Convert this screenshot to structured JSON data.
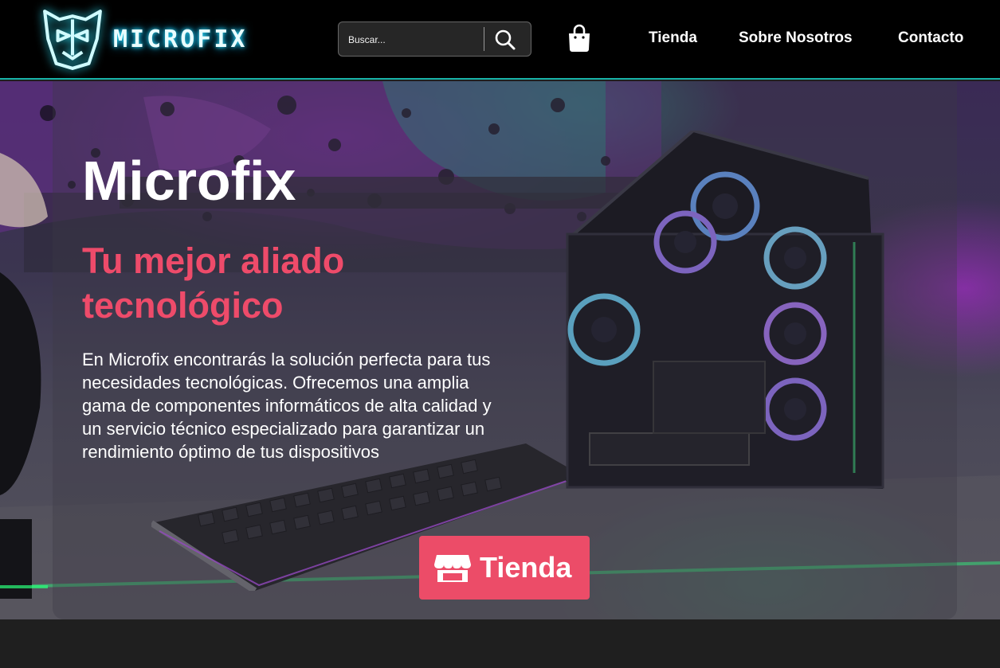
{
  "header": {
    "logo_text": "MICROFIX",
    "search": {
      "placeholder": "Buscar..."
    },
    "nav": [
      {
        "label": "Tienda"
      },
      {
        "label": "Sobre Nosotros"
      },
      {
        "label": "Contacto"
      }
    ],
    "icons": {
      "search": "search-icon",
      "cart": "shopping-bag-icon",
      "logo": "robot-mask-icon"
    }
  },
  "hero": {
    "title": "Microfix",
    "subtitle": "Tu mejor aliado tecnológico",
    "description": "En Microfix encontrarás la solución perfecta para tus necesidades tecnológicas. Ofrecemos una amplia gama de componentes informáticos de alta calidad y un servicio técnico especializado para garantizar un rendimiento óptimo de tus dispositivos",
    "cta": {
      "label": "Tienda",
      "icon": "store-icon"
    }
  },
  "colors": {
    "accent": "#ec4c68",
    "header_bg": "#000000",
    "header_border": "#17b3a8",
    "logo_glow": "#29e1ff",
    "page_bg": "#1f1f1f"
  }
}
